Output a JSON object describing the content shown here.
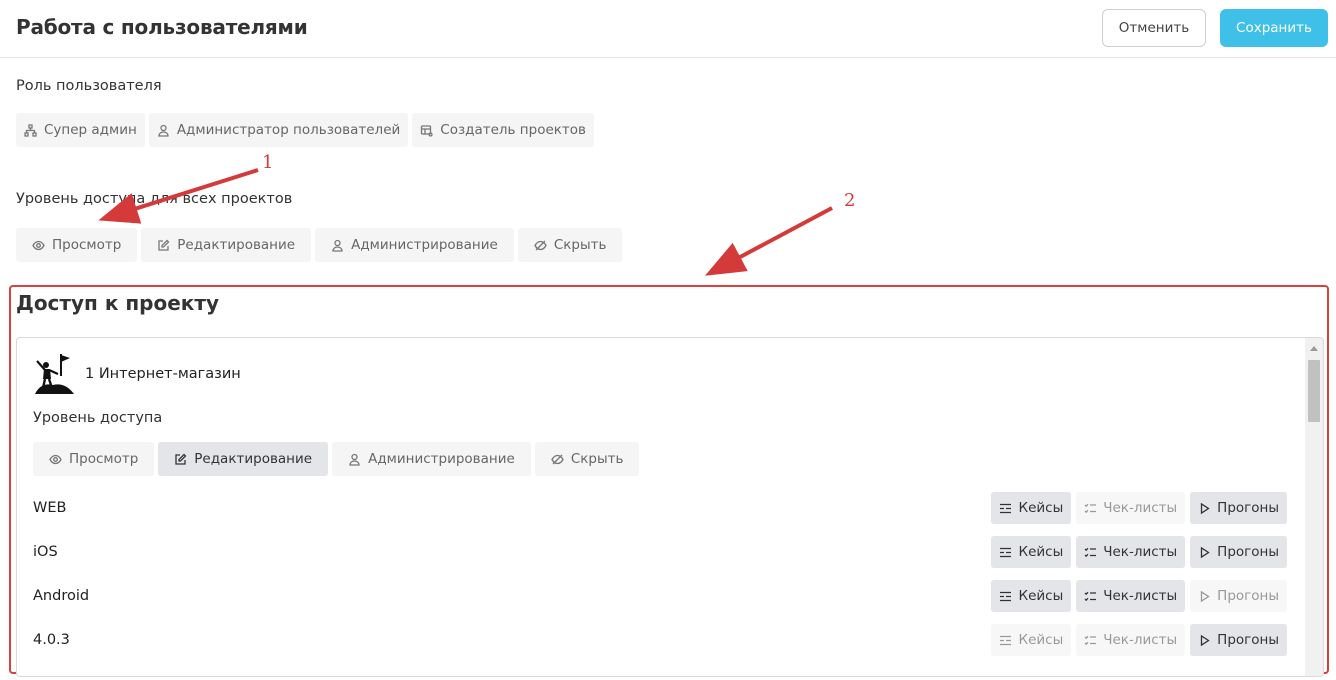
{
  "header": {
    "title": "Работа с пользователями",
    "cancel_label": "Отменить",
    "save_label": "Сохранить"
  },
  "role": {
    "label": "Роль пользователя",
    "options": [
      {
        "label": "Супер админ",
        "icon": "sitemap-icon"
      },
      {
        "label": "Администратор пользователей",
        "icon": "user-icon"
      },
      {
        "label": "Создатель проектов",
        "icon": "project-icon"
      }
    ]
  },
  "global_access": {
    "label": "Уровень доступа для всех проектов",
    "options": [
      {
        "label": "Просмотр",
        "icon": "eye-icon"
      },
      {
        "label": "Редактирование",
        "icon": "edit-icon"
      },
      {
        "label": "Администрирование",
        "icon": "user-icon"
      },
      {
        "label": "Скрыть",
        "icon": "eye-off-icon"
      }
    ],
    "selected": "Просмотр"
  },
  "annotations": [
    "1",
    "2"
  ],
  "project_section": {
    "title": "Доступ к проекту",
    "project": {
      "name": "1 Интернет-магазин",
      "access_label": "Уровень доступа",
      "access_options": [
        {
          "label": "Просмотр",
          "icon": "eye-icon"
        },
        {
          "label": "Редактирование",
          "icon": "edit-icon"
        },
        {
          "label": "Администрирование",
          "icon": "user-icon"
        },
        {
          "label": "Скрыть",
          "icon": "eye-off-icon"
        }
      ],
      "access_selected": "Редактирование",
      "button_labels": {
        "cases": "Кейсы",
        "checklists": "Чек-листы",
        "runs": "Прогоны"
      },
      "rows": [
        {
          "name": "WEB",
          "cases": true,
          "checklists": false,
          "runs": true
        },
        {
          "name": "iOS",
          "cases": true,
          "checklists": true,
          "runs": true
        },
        {
          "name": "Android",
          "cases": true,
          "checklists": true,
          "runs": false
        },
        {
          "name": "4.0.3",
          "cases": false,
          "checklists": false,
          "runs": true
        }
      ]
    }
  },
  "colors": {
    "accent": "#3ec0e8",
    "annotation": "#d53a3a",
    "active_segment": "#e3e5e8"
  }
}
